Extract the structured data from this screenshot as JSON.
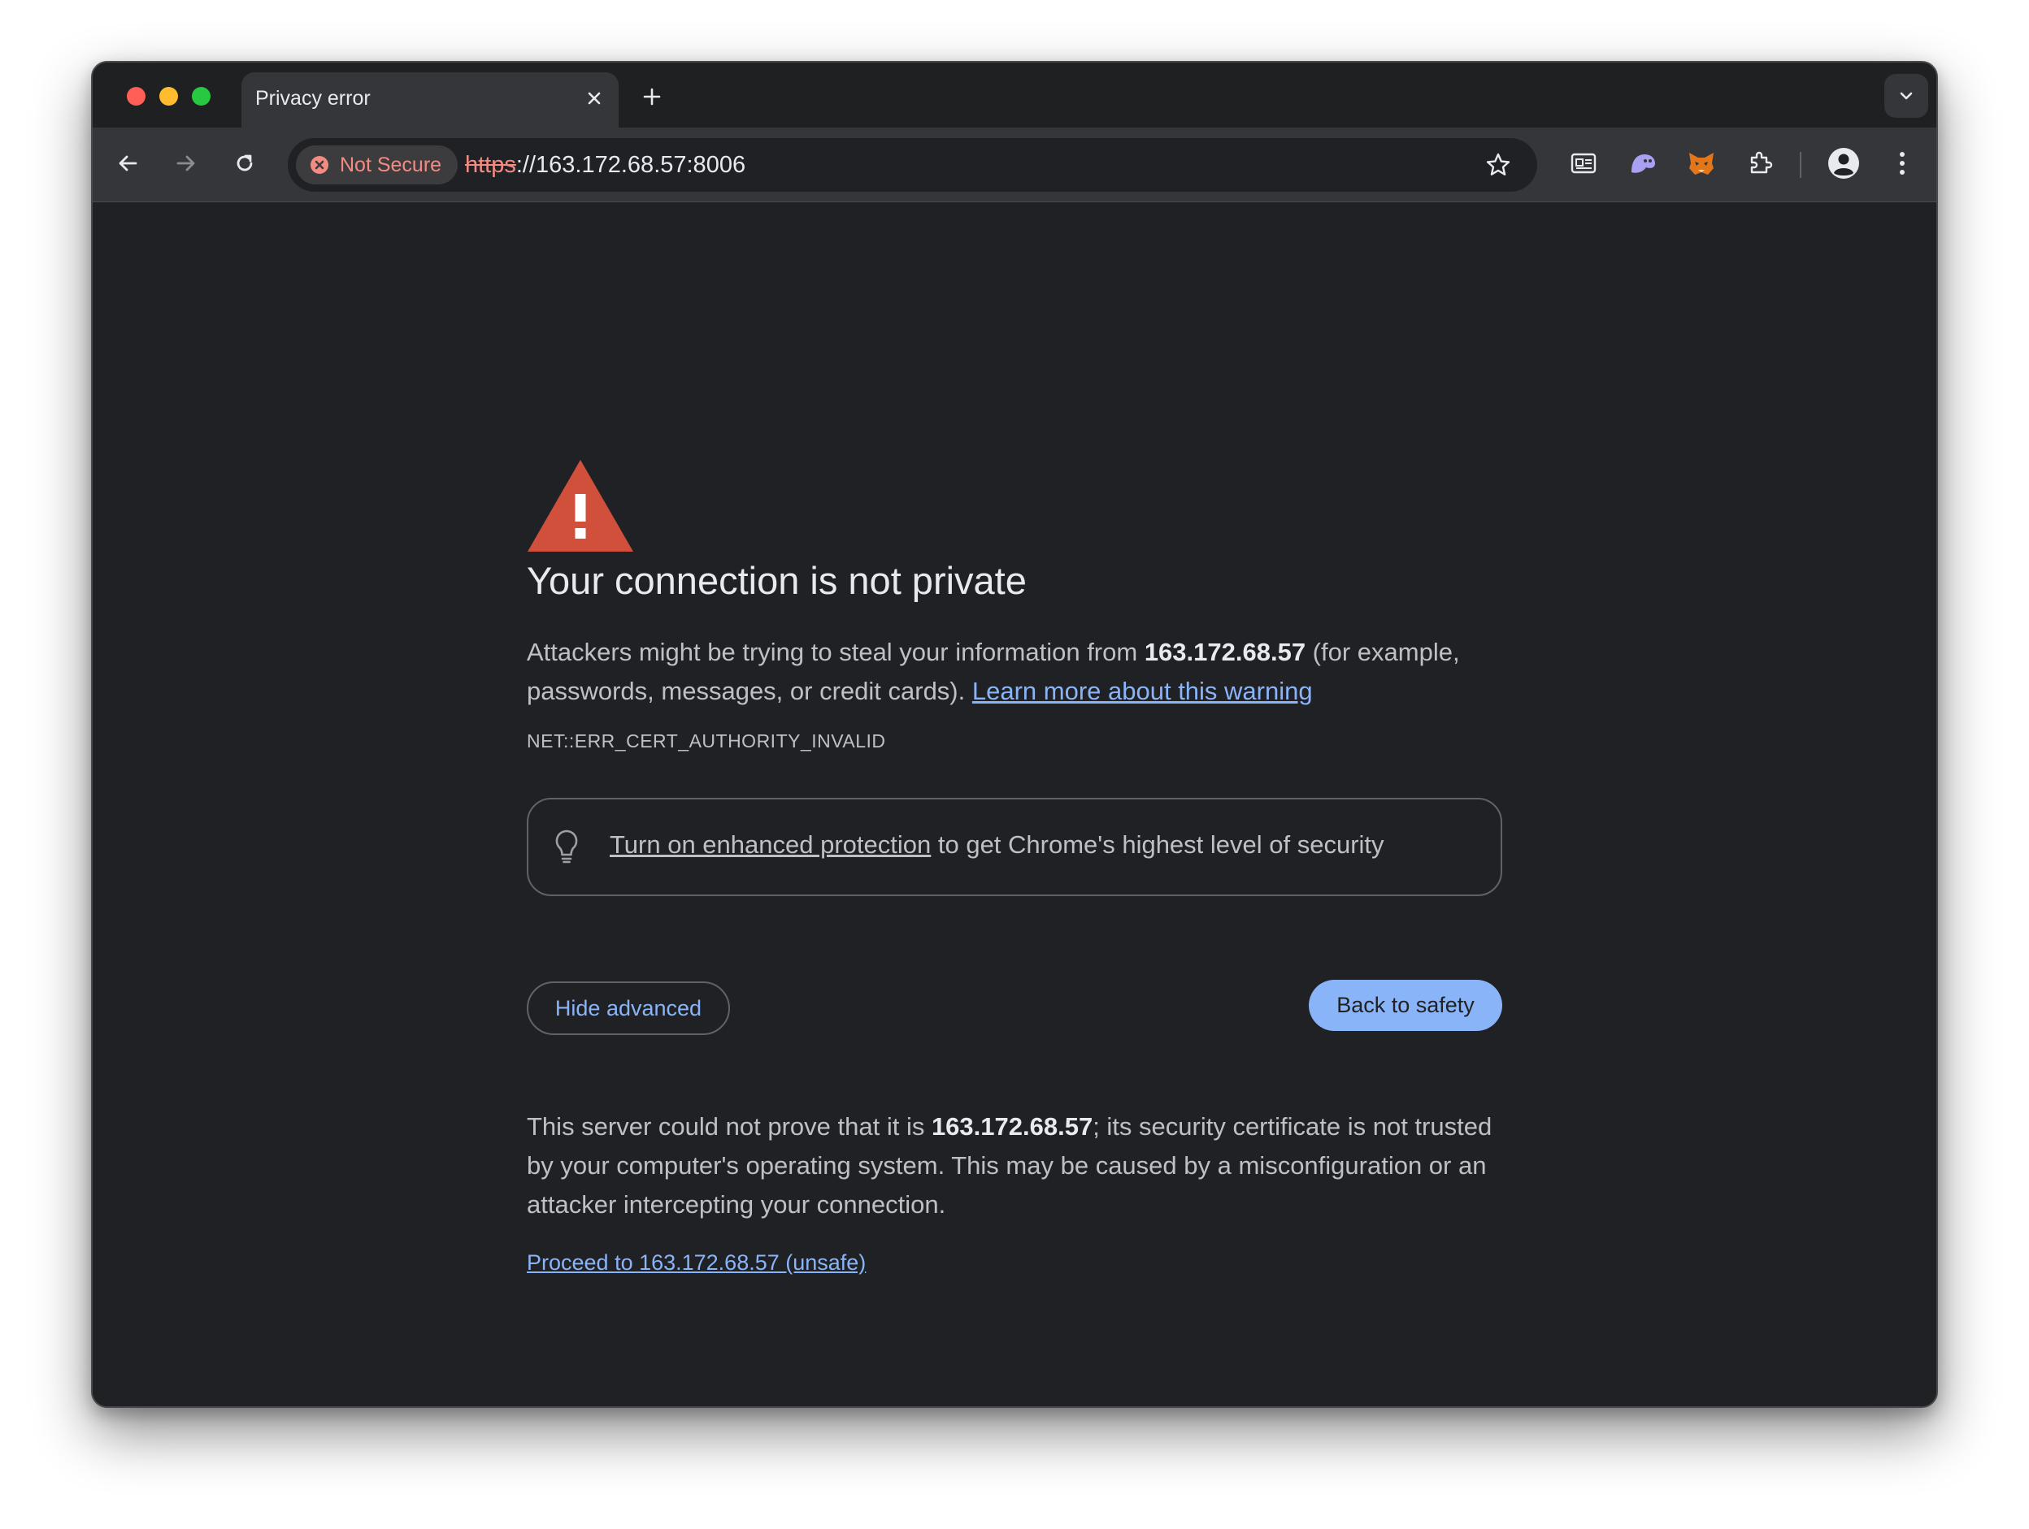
{
  "window": {
    "tab_title": "Privacy error"
  },
  "toolbar": {
    "security_chip_label": "Not Secure",
    "url_scheme": "https",
    "url_rest": "://163.172.68.57:8006"
  },
  "icons": {
    "back": "arrow-left-icon",
    "forward": "arrow-right-icon",
    "reload": "reload-icon",
    "bookmark": "star-icon",
    "extensions": [
      "reader-mode-icon",
      "ghost-extension-icon",
      "fox-extension-icon",
      "puzzle-extensions-icon"
    ],
    "profile": "profile-icon",
    "menu": "kebab-menu-icon",
    "warning": "warning-triangle-icon",
    "promo": "lightbulb-icon"
  },
  "colors": {
    "page_background": "#202124",
    "warning_red": "#d0503c",
    "link_blue": "#8ab4f8",
    "not_secure_red": "#f28b82"
  },
  "interstitial": {
    "heading": "Your connection is not private",
    "intro_pre": "Attackers might be trying to steal your information from ",
    "host": "163.172.68.57",
    "intro_post": " (for example, passwords, messages, or credit cards). ",
    "learn_more_link": "Learn more about this warning",
    "error_code": "NET::ERR_CERT_AUTHORITY_INVALID",
    "promo_link": "Turn on enhanced protection",
    "promo_rest": " to get Chrome's highest level of security",
    "hide_advanced_button": "Hide advanced",
    "back_to_safety_button": "Back to safety",
    "details_pre": "This server could not prove that it is ",
    "details_post": "; its security certificate is not trusted by your computer's operating system. This may be caused by a misconfiguration or an attacker intercepting your connection.",
    "proceed_link": "Proceed to 163.172.68.57 (unsafe)"
  }
}
